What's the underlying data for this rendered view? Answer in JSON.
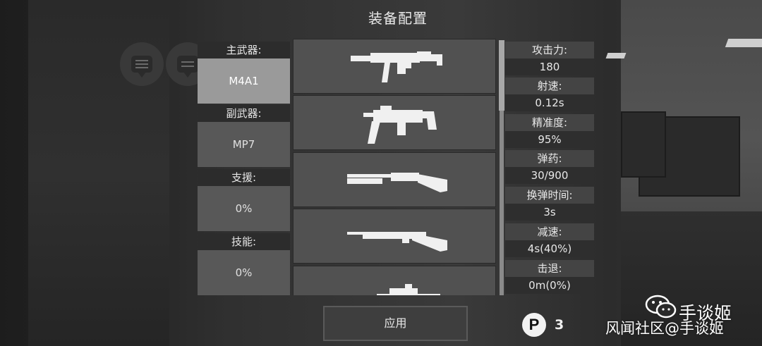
{
  "title": "装备配置",
  "loadout": [
    {
      "label": "主武器:",
      "value": "M4A1",
      "selected": true
    },
    {
      "label": "副武器:",
      "value": "MP7",
      "selected": false
    },
    {
      "label": "支援:",
      "value": "0%",
      "selected": false
    },
    {
      "label": "技能:",
      "value": "0%",
      "selected": false
    }
  ],
  "weapons": [
    {
      "icon": "mp5-silenced-icon"
    },
    {
      "icon": "ump-smg-icon"
    },
    {
      "icon": "shotgun-icon"
    },
    {
      "icon": "bolt-rifle-icon"
    },
    {
      "icon": "sniper-rifle-icon"
    }
  ],
  "stats": [
    {
      "key": "攻击力:",
      "value": "180"
    },
    {
      "key": "射速:",
      "value": "0.12s"
    },
    {
      "key": "精准度:",
      "value": "95%"
    },
    {
      "key": "弹药:",
      "value": "30/900"
    },
    {
      "key": "换弹时间:",
      "value": "3s"
    },
    {
      "key": "减速:",
      "value": "4s(40%)"
    },
    {
      "key": "击退:",
      "value": "0m(0%)"
    }
  ],
  "apply_label": "应用",
  "points": {
    "icon_letter": "P",
    "count": "3"
  },
  "watermark": {
    "name": "手谈姬",
    "line": "风闻社区@手谈姬"
  },
  "colors": {
    "selected_slot": "#9a9a9a",
    "slot": "#585858",
    "label_bar": "#2c2c2c"
  }
}
